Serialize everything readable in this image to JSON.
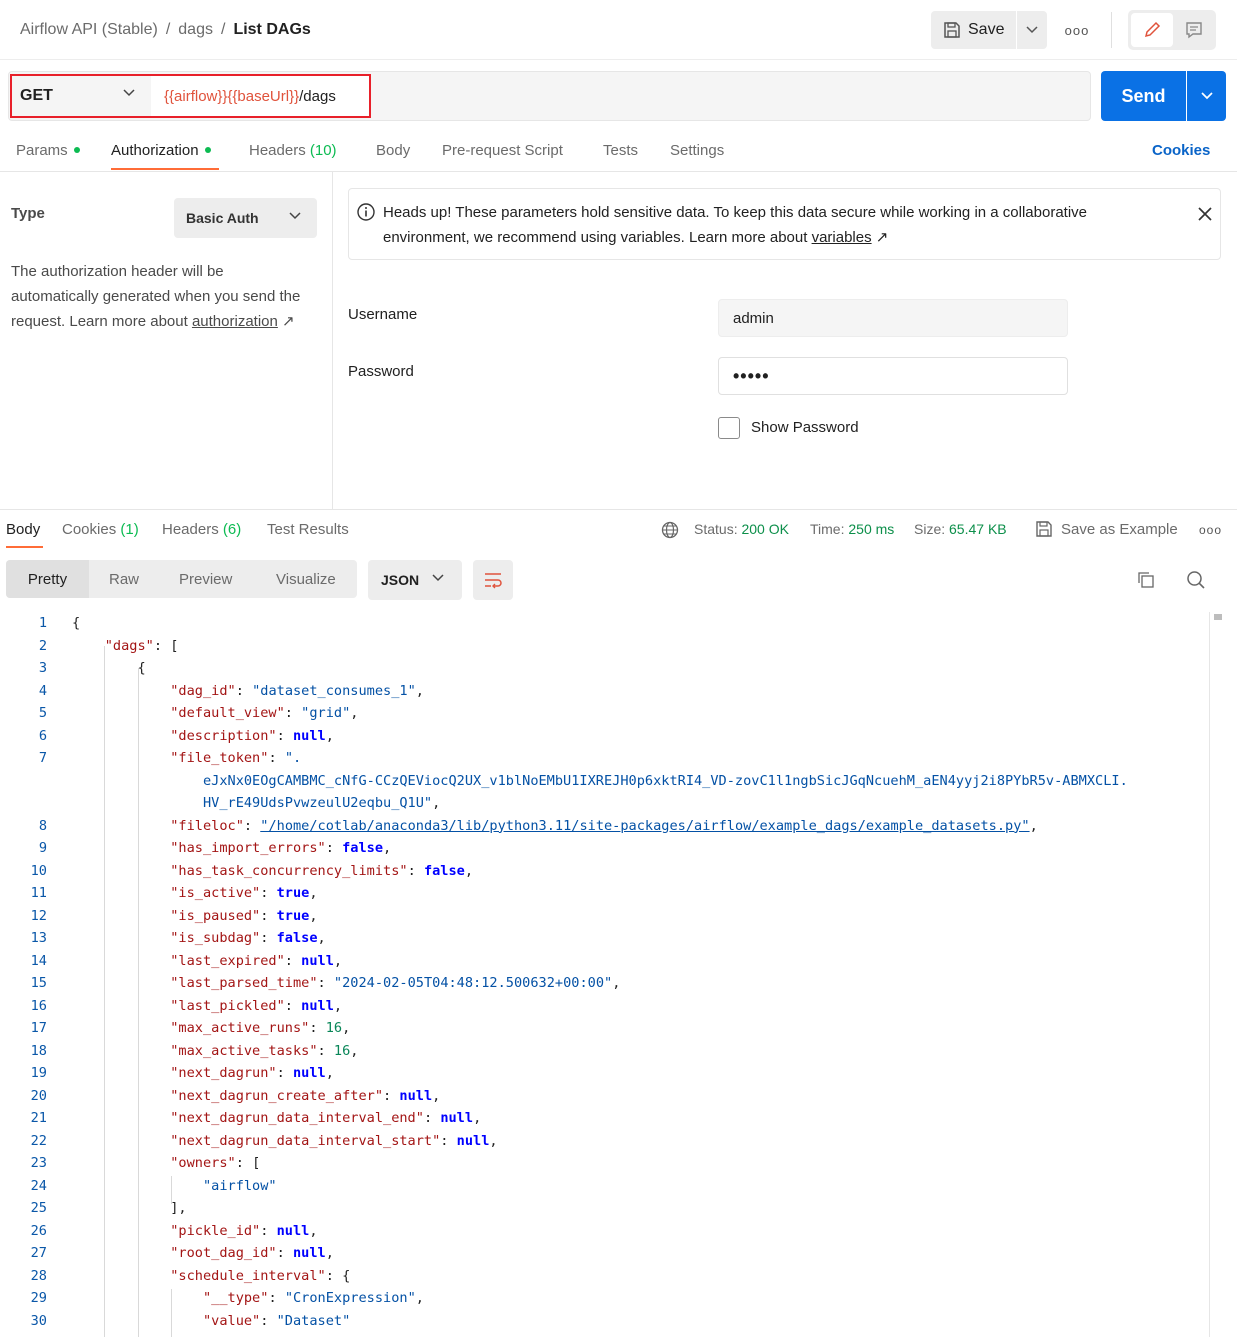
{
  "header": {
    "breadcrumb": [
      "Airflow API (Stable)",
      "dags",
      "List DAGs"
    ],
    "save_label": "Save"
  },
  "request": {
    "method": "GET",
    "url_var1": "{{airflow}}",
    "url_var2": "{{baseUrl}}",
    "url_path": "/dags",
    "send_label": "Send"
  },
  "req_tabs": {
    "params": "Params",
    "authorization": "Authorization",
    "headers": "Headers",
    "headers_count": "(10)",
    "body": "Body",
    "prerequest": "Pre-request Script",
    "tests": "Tests",
    "settings": "Settings",
    "cookies": "Cookies"
  },
  "auth": {
    "type_label": "Type",
    "type_value": "Basic Auth",
    "desc": "The authorization header will be automatically generated when you send the request. Learn more about",
    "desc_link": "authorization",
    "alert_text": "Heads up! These parameters hold sensitive data. To keep this data secure while working in a collaborative environment, we recommend using variables. Learn more about",
    "alert_link": "variables",
    "username_label": "Username",
    "username_value": "admin",
    "password_label": "Password",
    "password_value": "•••••",
    "show_password": "Show Password"
  },
  "response": {
    "tabs": {
      "body": "Body",
      "cookies": "Cookies",
      "cookies_count": "(1)",
      "headers": "Headers",
      "headers_count": "(6)",
      "test_results": "Test Results"
    },
    "status_label": "Status:",
    "status_value": "200 OK",
    "time_label": "Time:",
    "time_value": "250 ms",
    "size_label": "Size:",
    "size_value": "65.47 KB",
    "save_example": "Save as Example",
    "views": [
      "Pretty",
      "Raw",
      "Preview",
      "Visualize"
    ],
    "format": "JSON"
  },
  "code_line_numbers": [
    "1",
    "2",
    "3",
    "4",
    "5",
    "6",
    "7",
    "",
    "",
    "8",
    "9",
    "10",
    "11",
    "12",
    "13",
    "14",
    "15",
    "16",
    "17",
    "18",
    "19",
    "20",
    "21",
    "22",
    "23",
    "24",
    "25",
    "26",
    "27",
    "28",
    "29",
    "30"
  ],
  "code": {
    "dag_id": "\"dataset_consumes_1\"",
    "default_view": "\"grid\"",
    "file_token_a": "\".",
    "file_token_b": "eJxNx0EOgCAMBMC_cNfG-CCzQEViocQ2UX_v1blNoEMbU1IXREJH0p6xktRI4_VD-zovC1l1ngbSicJGqNcuehM_aEN4yyj2i8PYbR5v-ABMXCLI.",
    "file_token_c": "HV_rE49UdsPvwzeulU2eqbu_Q1U\"",
    "fileloc": "\"/home/cotlab/anaconda3/lib/python3.11/site-packages/airflow/example_dags/example_datasets.py\"",
    "last_parsed_time": "\"2024-02-05T04:48:12.500632+00:00\"",
    "max_active_runs": "16",
    "max_active_tasks": "16",
    "owner": "\"airflow\"",
    "schedule_type": "\"CronExpression\"",
    "schedule_value": "\"Dataset\""
  }
}
